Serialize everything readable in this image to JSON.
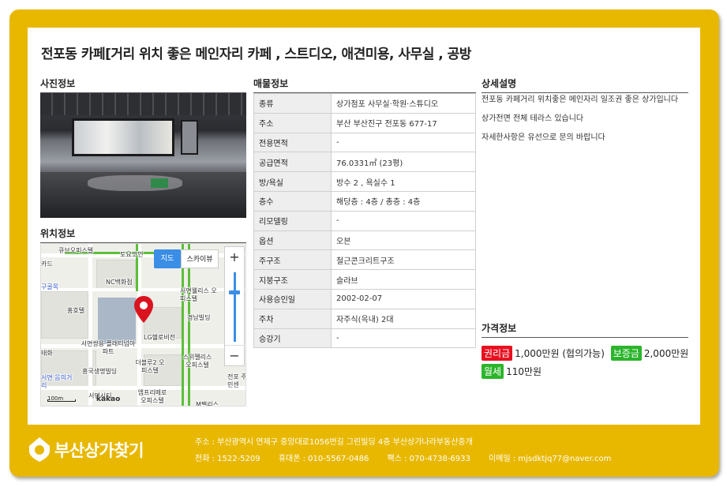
{
  "title": "전포동 카페[거리 위치 좋은 메인자리 카페 , 스트디오, 애견미용, 사무실 , 공방",
  "sections": {
    "photo": "사진정보",
    "location": "위치정보",
    "property": "매물정보",
    "detail": "상세설명",
    "price": "가격정보"
  },
  "map": {
    "map_button": "지도",
    "skyview_button": "스카이뷰",
    "zoom_in": "+",
    "zoom_out": "−",
    "scale": "100m",
    "provider": "kakao",
    "labels": [
      "큐브오피스텔",
      "토요코인",
      "카드",
      "NC백화점",
      "구골목",
      "홍호텔",
      "서면웰리스 오피스텔",
      "경남빌딩",
      "LG헬로비전",
      "서면쌍용 플래티넘아파트",
      "흥국생명빌딩",
      "더블루2 오피스텔",
      "스위펠리스 오피스텔",
      "서면 음의거리",
      "서면시티",
      "엠프리메로 오피스텔",
      "전포 주민센",
      "태화",
      "M팰리스"
    ]
  },
  "property": [
    {
      "key": "종류",
      "value": "상가점포 사무실·학원·스튜디오"
    },
    {
      "key": "주소",
      "value": "부산 부산진구 전포동 677-17"
    },
    {
      "key": "전용면적",
      "value": "-"
    },
    {
      "key": "공급면적",
      "value": "76.0331㎡ (23평)"
    },
    {
      "key": "방/욕실",
      "value": "방수 2 , 욕실수 1"
    },
    {
      "key": "층수",
      "value": "해당층 : 4층 / 총층 : 4층"
    },
    {
      "key": "리모델링",
      "value": "-"
    },
    {
      "key": "옵션",
      "value": "오븐"
    },
    {
      "key": "주구조",
      "value": "철근콘크리트구조"
    },
    {
      "key": "지붕구조",
      "value": "슬라브"
    },
    {
      "key": "사용승인일",
      "value": "2002-02-07"
    },
    {
      "key": "주차",
      "value": "자주식(옥내) 2대"
    },
    {
      "key": "승강기",
      "value": "-"
    }
  ],
  "description": [
    "전포동 카페거리 위치좋은 메인자리 일조권 좋은 상가입니다",
    "상가전면 전체 테라스 있습니다",
    "자세한사항은 유선으로 문의 바랍니다"
  ],
  "price": {
    "premium_label": "권리금",
    "premium_value": "1,000만원 (협의가능)",
    "deposit_label": "보증금",
    "deposit_value": "2,000만원",
    "monthly_label": "월세",
    "monthly_value": "110만원"
  },
  "footer": {
    "brand": "부산상가찾기",
    "address": "주소 : 부산광역시 연제구 중앙대로1056번길 그린빌딩 4층 부산상가나라부동산중개",
    "phone": "전화 : 1522-5209",
    "mobile": "휴대폰 : 010-5567-0486",
    "fax": "팩스 : 070-4738-6933",
    "email": "이메일 : mjsdktjq77@naver.com"
  },
  "colors": {
    "frame": "#e8b800",
    "badge_red": "#e8101f",
    "badge_green": "#2bb52b",
    "map_active": "#3a8ee6",
    "marker": "#d9141e"
  }
}
